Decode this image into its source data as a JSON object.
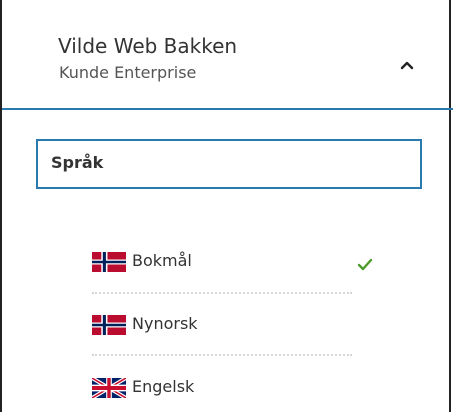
{
  "user": {
    "name": "Vilde Web Bakken",
    "role": "Kunde Enterprise"
  },
  "section": {
    "title": "Språk"
  },
  "languages": [
    {
      "label": "Bokmål",
      "flag": "norway-flag",
      "selected": true
    },
    {
      "label": "Nynorsk",
      "flag": "norway-flag",
      "selected": false
    },
    {
      "label": "Engelsk",
      "flag": "uk-flag",
      "selected": false
    }
  ],
  "icons": {
    "collapse": "chevron-up-icon",
    "selected": "checkmark-icon"
  },
  "colors": {
    "accent": "#2a7ab0",
    "check": "#4f9a2a",
    "norway_red": "#ba0c2f",
    "norway_blue": "#00205b",
    "uk_blue": "#012169",
    "uk_red": "#c8102e"
  }
}
